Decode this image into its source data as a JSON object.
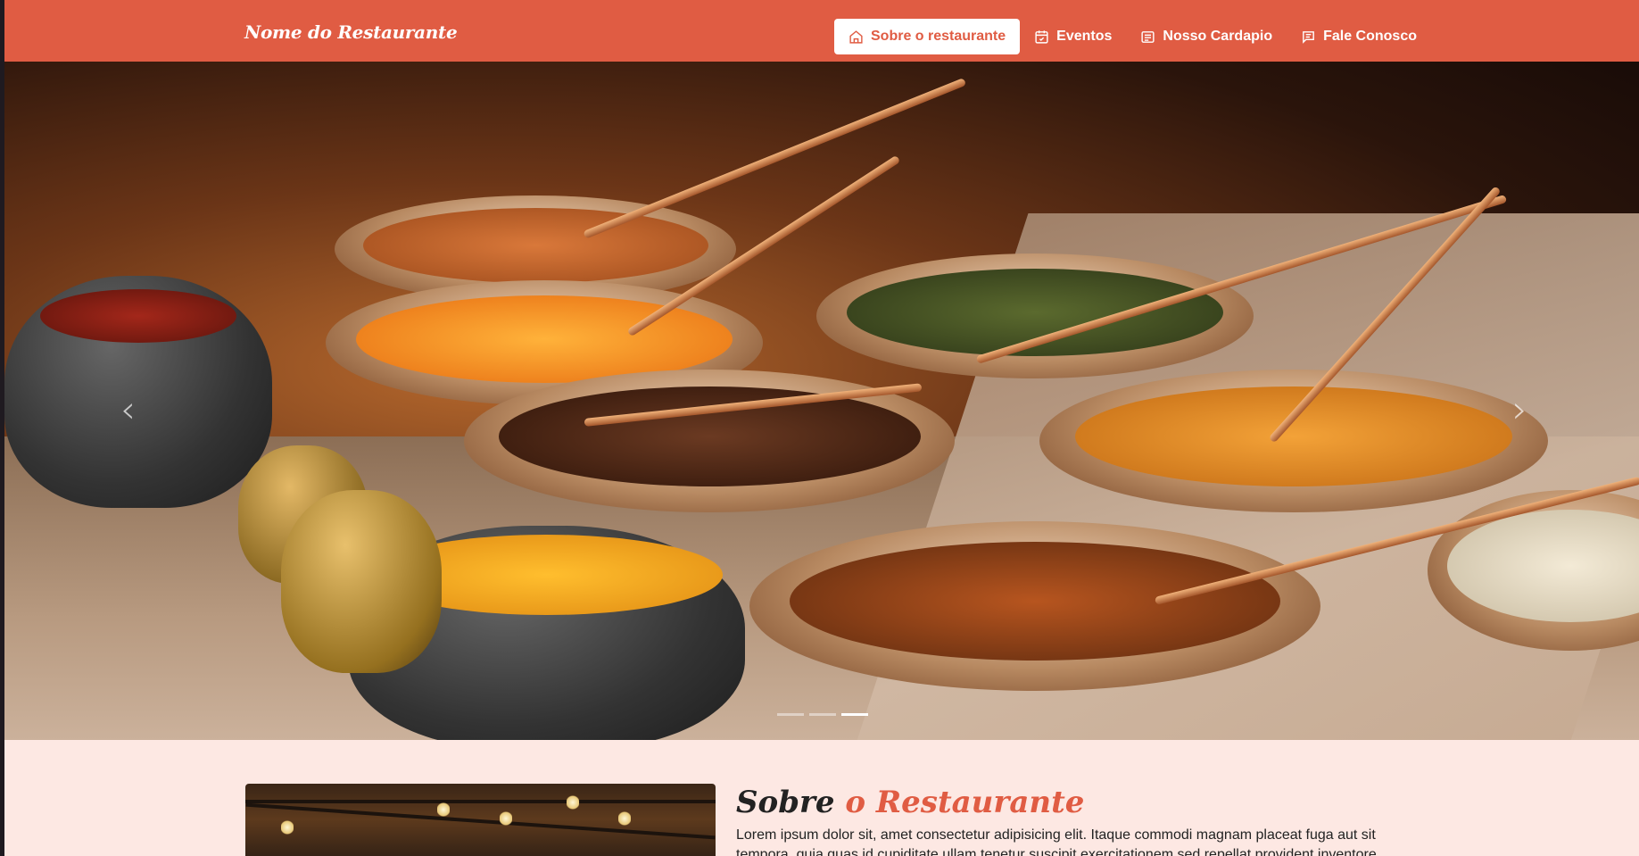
{
  "brand": "Nome do Restaurante",
  "nav": [
    {
      "label": "Sobre o restaurante",
      "icon": "home-icon",
      "active": true
    },
    {
      "label": "Eventos",
      "icon": "calendar-icon",
      "active": false
    },
    {
      "label": "Nosso Cardapio",
      "icon": "menu-card-icon",
      "active": false
    },
    {
      "label": "Fale Conosco",
      "icon": "chat-icon",
      "active": false
    }
  ],
  "carousel": {
    "prev_icon": "‹",
    "next_icon": "›",
    "slide_count": 3,
    "active_index": 2
  },
  "about": {
    "title_part1": "Sobre",
    "title_part2": "o Restaurante",
    "text": "Lorem ipsum dolor sit, amet consectetur adipisicing elit. Itaque commodi magnam placeat fuga aut sit tempora, quia quas id cupiditate ullam tenetur suscipit exercitationem sed repellat provident inventore."
  },
  "colors": {
    "brand": "#e05c43",
    "background": "#fde8e3"
  }
}
